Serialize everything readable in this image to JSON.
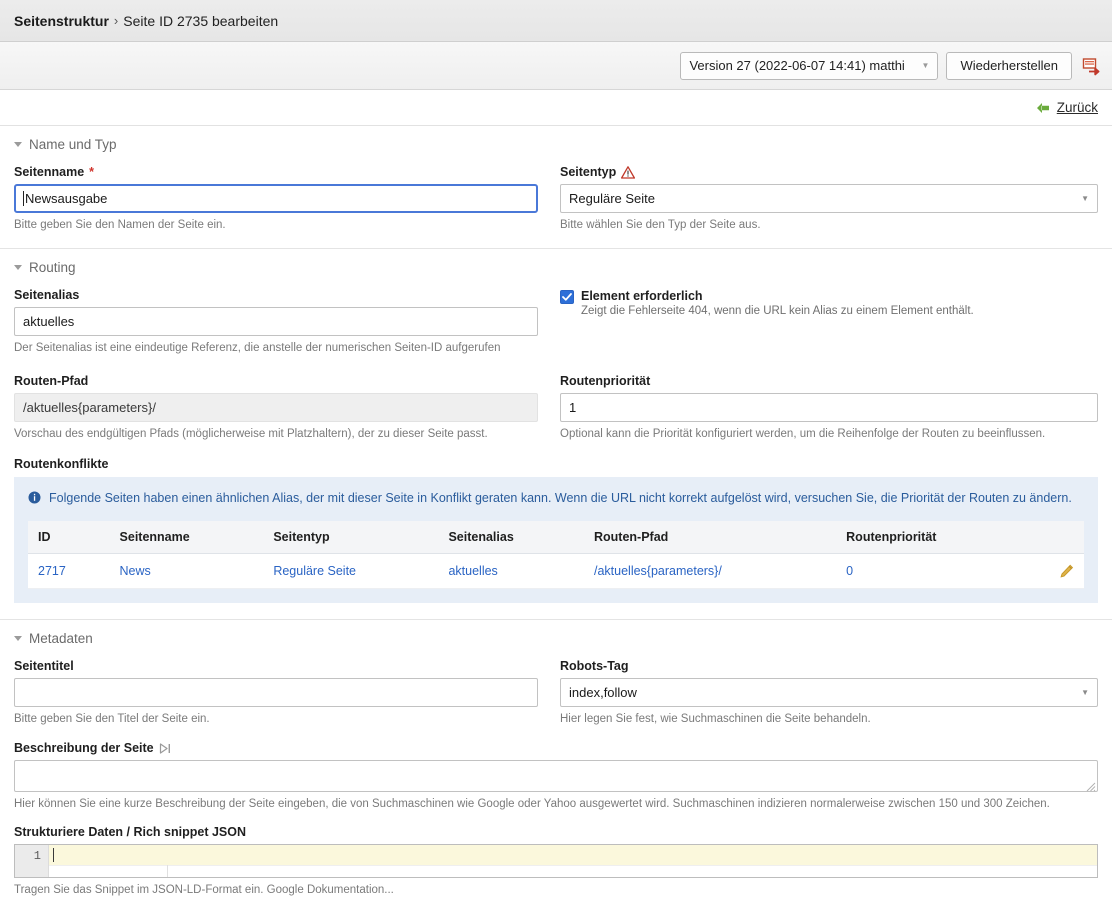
{
  "breadcrumb": {
    "root": "Seitenstruktur",
    "separator": "›",
    "current": "Seite ID 2735 bearbeiten"
  },
  "toolbar": {
    "version_value": "Version 27 (2022-06-07 14:41) matthi",
    "version_caret": "▼",
    "restore_label": "Wiederherstellen",
    "export_icon": "export-icon"
  },
  "back": {
    "label": "Zurück",
    "icon": "arrow-left-icon"
  },
  "sections": {
    "name_type": {
      "title": "Name und Typ",
      "seitenname": {
        "label": "Seitenname",
        "required_mark": "*",
        "value": "Newsausgabe",
        "hint": "Bitte geben Sie den Namen der Seite ein."
      },
      "seitentyp": {
        "label": "Seitentyp",
        "warning_icon": "warning-triangle-icon",
        "value": "Reguläre Seite",
        "caret": "▼",
        "hint": "Bitte wählen Sie den Typ der Seite aus."
      }
    },
    "routing": {
      "title": "Routing",
      "seitenalias": {
        "label": "Seitenalias",
        "value": "aktuelles",
        "hint": "Der Seitenalias ist eine eindeutige Referenz, die anstelle der numerischen Seiten-ID aufgerufen"
      },
      "element_required": {
        "label": "Element erforderlich",
        "checked": true,
        "hint": "Zeigt die Fehlerseite 404, wenn die URL kein Alias zu einem Element enthält."
      },
      "routen_pfad": {
        "label": "Routen-Pfad",
        "value": "/aktuelles{parameters}/",
        "hint": "Vorschau des endgültigen Pfads (möglicherweise mit Platzhaltern), der zu dieser Seite passt."
      },
      "routenprioritaet": {
        "label": "Routenpriorität",
        "value": "1",
        "hint": "Optional kann die Priorität konfiguriert werden, um die Reihenfolge der Routen zu beeinflussen."
      },
      "conflicts": {
        "label": "Routenkonflikte",
        "info_icon": "info-circle-icon",
        "message": "Folgende Seiten haben einen ähnlichen Alias, der mit dieser Seite in Konflikt geraten kann. Wenn die URL nicht korrekt aufgelöst wird, versuchen Sie, die Priorität der Routen zu ändern.",
        "columns": [
          "ID",
          "Seitenname",
          "Seitentyp",
          "Seitenalias",
          "Routen-Pfad",
          "Routenpriorität",
          ""
        ],
        "rows": [
          {
            "id": "2717",
            "seitenname": "News",
            "seitentyp": "Reguläre Seite",
            "seitenalias": "aktuelles",
            "routen_pfad": "/aktuelles{parameters}/",
            "routenprioritaet": "0",
            "edit_icon": "pencil-icon"
          }
        ]
      }
    },
    "metadaten": {
      "title": "Metadaten",
      "seitentitel": {
        "label": "Seitentitel",
        "value": "",
        "hint": "Bitte geben Sie den Titel der Seite ein."
      },
      "robots_tag": {
        "label": "Robots-Tag",
        "value": "index,follow",
        "caret": "▼",
        "hint": "Hier legen Sie fest, wie Suchmaschinen die Seite behandeln."
      },
      "beschreibung": {
        "label": "Beschreibung der Seite",
        "icon": "skip-to-end-icon",
        "value": "",
        "hint": "Hier können Sie eine kurze Beschreibung der Seite eingeben, die von Suchmaschinen wie Google oder Yahoo ausgewertet wird. Suchmaschinen indizieren normalerweise zwischen 150 und 300 Zeichen."
      },
      "rich_snippet": {
        "label": "Strukturiere Daten / Rich snippet JSON",
        "line_number": "1",
        "value": "",
        "hint": "Tragen Sie das Snippet im JSON-LD-Format ein. Google Dokumentation..."
      }
    }
  },
  "colors": {
    "accent_blue": "#2a64c4",
    "focus_blue": "#4a78d8",
    "info_bg": "#e7eef7",
    "warning_red": "#d0342c",
    "pencil_gold": "#d6a42e",
    "back_green": "#6aab3c",
    "active_line_yellow": "#fbf8dc"
  }
}
